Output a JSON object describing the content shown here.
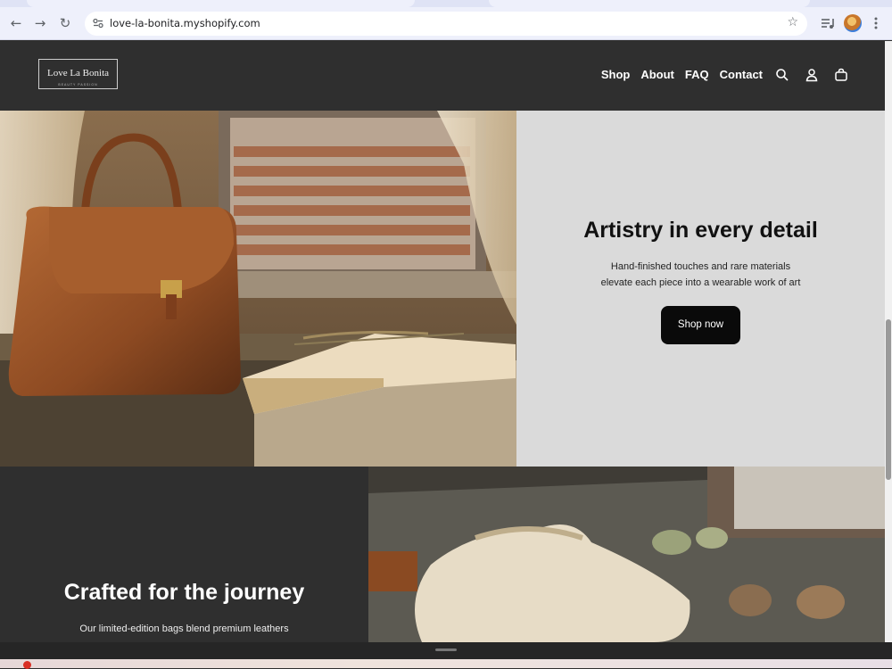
{
  "browser": {
    "url": "love-la-bonita.myshopify.com",
    "icons": [
      "back-arrow-icon",
      "forward-arrow-icon",
      "reload-icon",
      "site-info-icon",
      "bookmark-star-icon",
      "media-control-icon",
      "profile-avatar",
      "kebab-menu-icon"
    ]
  },
  "header": {
    "logo_name": "Love La Bonita",
    "logo_tagline": "BEAUTY PASSION",
    "nav": [
      "Shop",
      "About",
      "FAQ",
      "Contact"
    ],
    "icons": [
      "search-icon",
      "account-icon",
      "cart-icon"
    ]
  },
  "hero1": {
    "title": "Artistry in every detail",
    "text_line1": "Hand-finished touches and rare materials",
    "text_line2": "elevate each piece into a wearable work of art",
    "button": "Shop now",
    "image": "leather handbag on windowsill with open book"
  },
  "hero2": {
    "title": "Crafted for the journey",
    "text": "Our limited-edition bags blend premium leathers",
    "image": "canvas drawstring dust bag with stones"
  },
  "colors": {
    "header_bg": "#2f2f2f",
    "panel_light": "#dadada",
    "button_bg": "#0a0a0a"
  }
}
